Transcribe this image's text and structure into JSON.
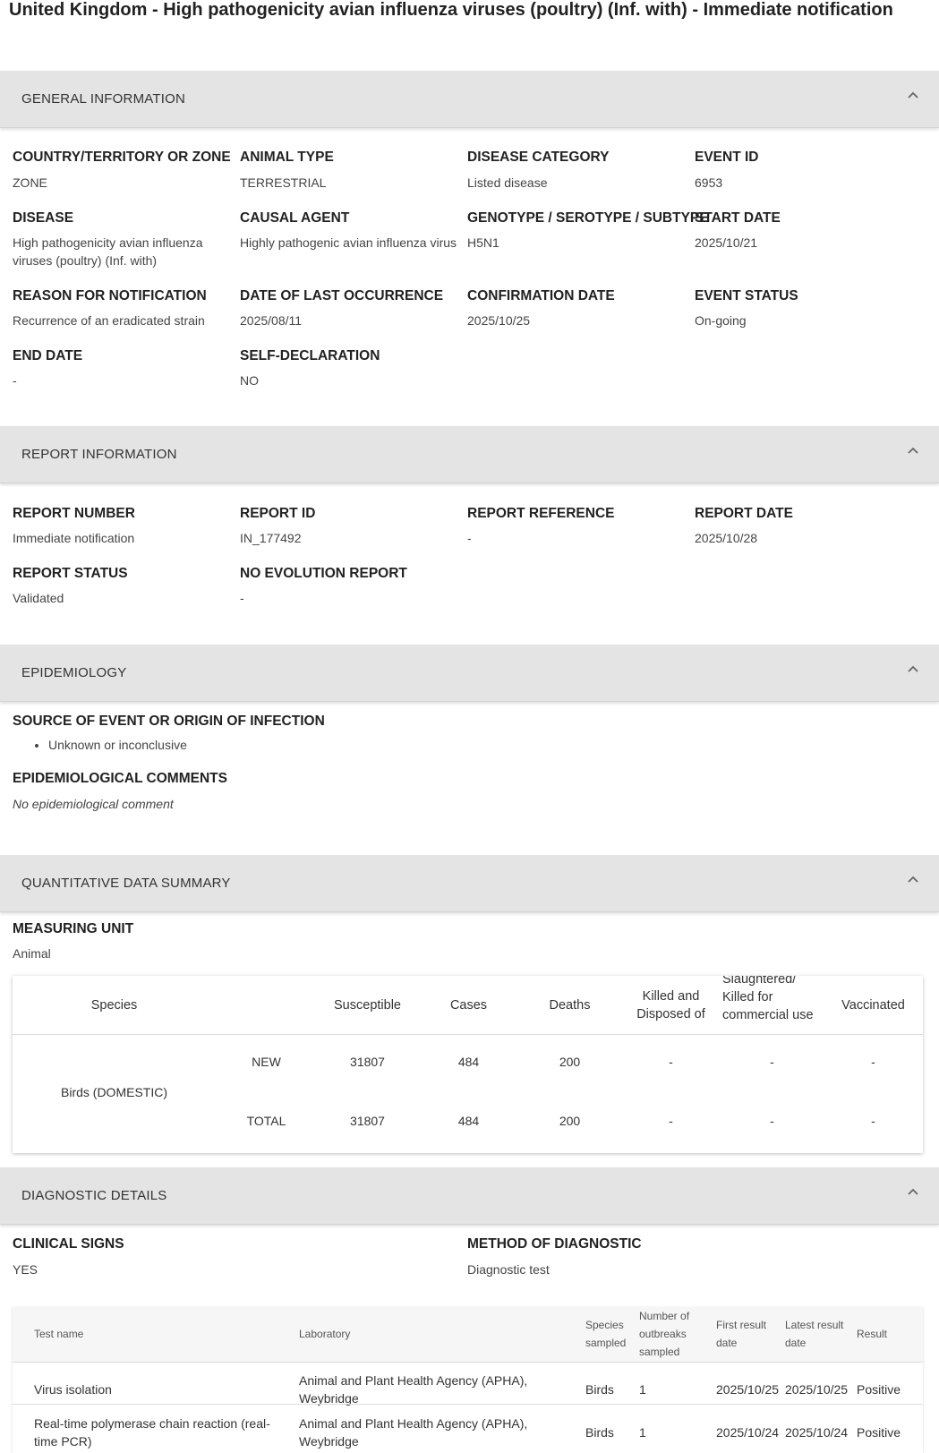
{
  "page_title": "United Kingdom - High pathogenicity avian influenza viruses (poultry) (Inf. with) - Immediate notification",
  "general": {
    "header": "GENERAL INFORMATION",
    "fields": [
      {
        "label": "COUNTRY/TERRITORY OR ZONE",
        "value": "ZONE"
      },
      {
        "label": "ANIMAL TYPE",
        "value": "TERRESTRIAL"
      },
      {
        "label": "DISEASE CATEGORY",
        "value": "Listed disease"
      },
      {
        "label": "EVENT ID",
        "value": "6953"
      },
      {
        "label": "DISEASE",
        "value": "High pathogenicity avian influenza viruses (poultry) (Inf. with)"
      },
      {
        "label": "CAUSAL AGENT",
        "value": "Highly pathogenic avian influenza virus"
      },
      {
        "label": "GENOTYPE / SEROTYPE / SUBTYPE",
        "value": "H5N1"
      },
      {
        "label": "START DATE",
        "value": "2025/10/21"
      },
      {
        "label": "REASON FOR NOTIFICATION",
        "value": "Recurrence of an eradicated strain"
      },
      {
        "label": "DATE OF LAST OCCURRENCE",
        "value": "2025/08/11"
      },
      {
        "label": "CONFIRMATION DATE",
        "value": "2025/10/25"
      },
      {
        "label": "EVENT STATUS",
        "value": "On-going"
      },
      {
        "label": "END DATE",
        "value": "-"
      },
      {
        "label": "SELF-DECLARATION",
        "value": "NO"
      }
    ]
  },
  "report": {
    "header": "REPORT INFORMATION",
    "fields": [
      {
        "label": "REPORT NUMBER",
        "value": "Immediate notification"
      },
      {
        "label": "REPORT ID",
        "value": "IN_177492"
      },
      {
        "label": "REPORT REFERENCE",
        "value": "-"
      },
      {
        "label": "REPORT DATE",
        "value": "2025/10/28"
      },
      {
        "label": "REPORT STATUS",
        "value": "Validated"
      },
      {
        "label": "NO EVOLUTION REPORT",
        "value": "-"
      }
    ]
  },
  "epidemiology": {
    "header": "EPIDEMIOLOGY",
    "source_label": "SOURCE OF EVENT OR ORIGIN OF INFECTION",
    "sources": [
      "Unknown or inconclusive"
    ],
    "comments_label": "EPIDEMIOLOGICAL COMMENTS",
    "comments": "No epidemiological comment"
  },
  "quantitative": {
    "header": "QUANTITATIVE DATA SUMMARY",
    "unit_label": "MEASURING UNIT",
    "unit": "Animal",
    "columns": [
      "Species",
      "Susceptible",
      "Cases",
      "Deaths",
      "Killed and Disposed of",
      "Slaughtered/ Killed for commercial use",
      "Vaccinated"
    ],
    "species": "Birds (DOMESTIC)",
    "rows": [
      {
        "type": "NEW",
        "susceptible": "31807",
        "cases": "484",
        "deaths": "200",
        "killed": "-",
        "slaughtered": "-",
        "vaccinated": "-"
      },
      {
        "type": "TOTAL",
        "susceptible": "31807",
        "cases": "484",
        "deaths": "200",
        "killed": "-",
        "slaughtered": "-",
        "vaccinated": "-"
      }
    ]
  },
  "diagnostic": {
    "header": "DIAGNOSTIC DETAILS",
    "clinical_label": "CLINICAL SIGNS",
    "clinical": "YES",
    "method_label": "METHOD OF DIAGNOSTIC",
    "method": "Diagnostic test",
    "columns": [
      "Test name",
      "Laboratory",
      "Species sampled",
      "Number of outbreaks sampled",
      "First result date",
      "Latest result date",
      "Result"
    ],
    "rows": [
      {
        "test": "Virus isolation",
        "lab": "Animal and Plant Health Agency (APHA), Weybridge",
        "species": "Birds",
        "outbreaks": "1",
        "first": "2025/10/25",
        "latest": "2025/10/25",
        "result": "Positive"
      },
      {
        "test": "Real-time polymerase chain reaction (real-time PCR)",
        "lab": "Animal and Plant Health Agency (APHA), Weybridge",
        "species": "Birds",
        "outbreaks": "1",
        "first": "2025/10/24",
        "latest": "2025/10/24",
        "result": "Positive"
      }
    ]
  }
}
